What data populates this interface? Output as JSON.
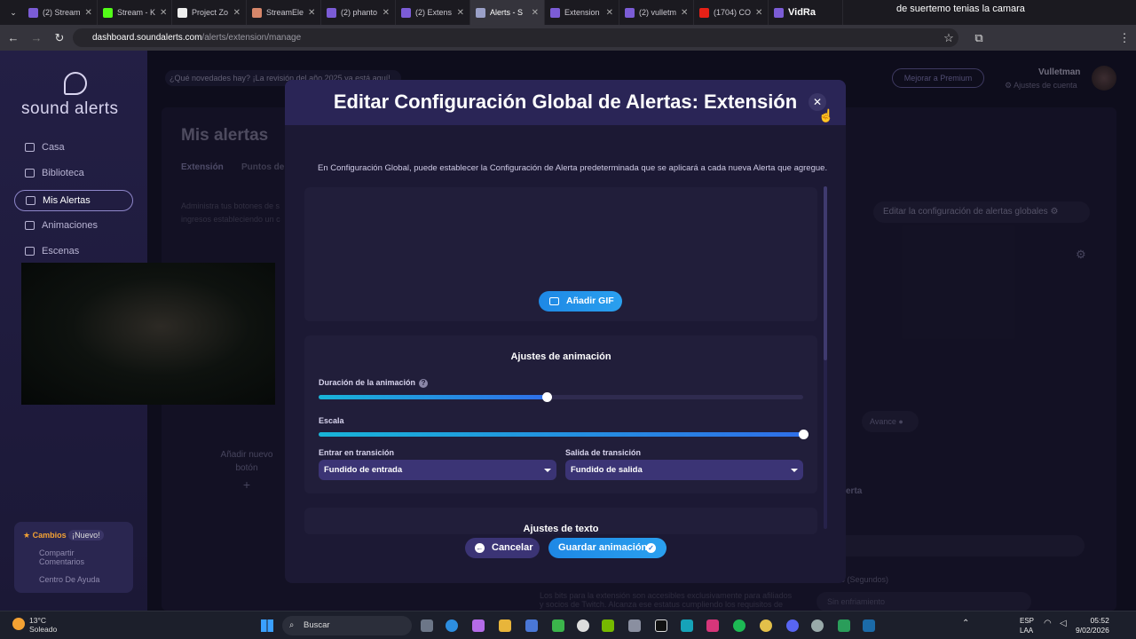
{
  "browser": {
    "tabs": [
      {
        "label": "(2) Stream"
      },
      {
        "label": "Stream - K"
      },
      {
        "label": "Project Zo"
      },
      {
        "label": "StreamEle"
      },
      {
        "label": "(2) phanto"
      },
      {
        "label": "(2) Extens"
      },
      {
        "label": "Alerts - S"
      },
      {
        "label": "Extension"
      },
      {
        "label": "(2) vulletm"
      },
      {
        "label": "(1704) CO"
      },
      {
        "label": "VidRa"
      }
    ],
    "overlay_text": "de suertemo tenias la camara",
    "url_host": "dashboard.soundalerts.com",
    "url_path": "/alerts/extension/manage"
  },
  "sidebar": {
    "logo": "sound alerts",
    "items": [
      {
        "label": "Casa"
      },
      {
        "label": "Biblioteca"
      },
      {
        "label": "Mis Alertas"
      },
      {
        "label": "Animaciones"
      },
      {
        "label": "Escenas"
      }
    ],
    "help": {
      "changes": "Cambios",
      "new_badge": "¡Nuevo!",
      "share": "Compartir Comentarios",
      "help_center": "Centro De Ayuda"
    }
  },
  "header": {
    "news": "¿Qué novedades hay?",
    "news_link": "¡La revisión del año 2025 ya está aquí!",
    "premium": "Mejorar a Premium",
    "username": "Vulletman",
    "account": "Ajustes de cuenta"
  },
  "page": {
    "title": "Mis alertas",
    "tab_extension": "Extensión",
    "tab_points": "Puntos de",
    "desc_line1": "Administra tus botones de s",
    "desc_line2": "ingresos estableciendo un c",
    "global_button": "Editar la configuración de alertas globales",
    "add_new": "Añadir nuevo botón",
    "avance": "Avance",
    "alert_label": "erta",
    "bits_text": "Los bits para la extensión son accesibles exclusivamente para afiliados",
    "bits_text2": "y socios de Twitch. Alcanza ese estatus cumpliendo los requisitos de",
    "cooldown_label": "amiento (Segundos)",
    "cooldown_value": "Sin enfriamiento"
  },
  "modal": {
    "title": "Editar Configuración Global de Alertas: Extensión",
    "intro": "En Configuración Global, puede establecer la Configuración de Alerta predeterminada que se aplicará a cada nueva Alerta que agregue.",
    "add_gif": "Añadir GIF",
    "anim_section": "Ajustes de animación",
    "duration_label": "Duración de la animación",
    "duration_level": 0.47,
    "scale_label": "Escala",
    "scale_level": 1.0,
    "enter_label": "Entrar en transición",
    "enter_value": "Fundido de entrada",
    "exit_label": "Salida de transición",
    "exit_value": "Fundido de salida",
    "text_section": "Ajustes de texto",
    "cancel": "Cancelar",
    "save": "Guardar animación"
  },
  "taskbar": {
    "temp": "13°C",
    "weather": "Soleado",
    "search": "Buscar",
    "lang1": "ESP",
    "lang2": "LAA",
    "time": "05:52",
    "date": "9/02/2026"
  },
  "colors": {
    "accent": "#2aa0ef",
    "modal_header": "#2a2556",
    "select_bg": "#3b3475"
  }
}
